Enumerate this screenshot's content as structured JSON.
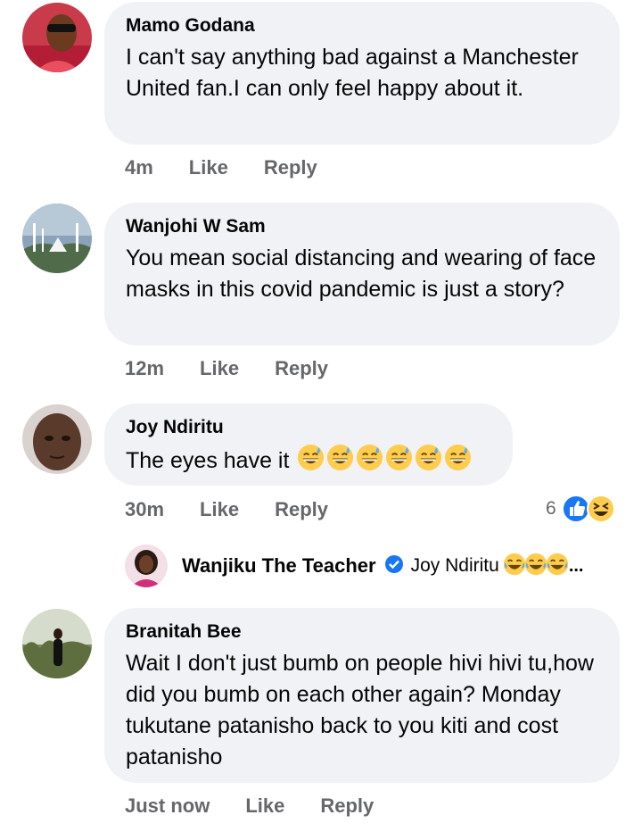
{
  "comments": [
    {
      "author": "Mamo Godana",
      "text": "I can't say anything bad against a Manchester United fan.I can only feel happy about it.",
      "time": "4m",
      "like_label": "Like",
      "reply_label": "Reply"
    },
    {
      "author": "Wanjohi W Sam",
      "text": "You mean social distancing and wearing of face masks in this covid pandemic is just a story?",
      "time": "12m",
      "like_label": "Like",
      "reply_label": "Reply"
    },
    {
      "author": "Joy Ndiritu",
      "text": "The eyes have it",
      "emoji": [
        "grinning-sweat-emoji",
        "grinning-sweat-emoji",
        "grinning-sweat-emoji",
        "grinning-sweat-emoji",
        "grinning-sweat-emoji",
        "grinning-sweat-emoji"
      ],
      "time": "30m",
      "like_label": "Like",
      "reply_label": "Reply",
      "reaction_count": "6",
      "reaction_icons": [
        "like-reaction-icon",
        "haha-reaction-icon"
      ]
    },
    {
      "author": "Branitah Bee",
      "text": "Wait I don't just bumb on people hivi hivi tu,how did you bumb on each other again? Monday tukutane patanisho back to you kiti and cost patanisho",
      "time": "Just now",
      "like_label": "Like",
      "reply_label": "Reply"
    }
  ],
  "reply_preview": {
    "author": "Wanjiku The Teacher",
    "verified_icon": "verified-badge-icon",
    "text": "Joy Ndiritu",
    "emoji": [
      "tears-of-joy-emoji",
      "tears-of-joy-emoji",
      "tears-of-joy-emoji"
    ],
    "ellipsis": "..."
  },
  "colors": {
    "bubble": "#f0f2f5",
    "meta_text": "#65676b",
    "like_blue": "#1877f2",
    "emoji_yellow": "#ffcc4d"
  }
}
